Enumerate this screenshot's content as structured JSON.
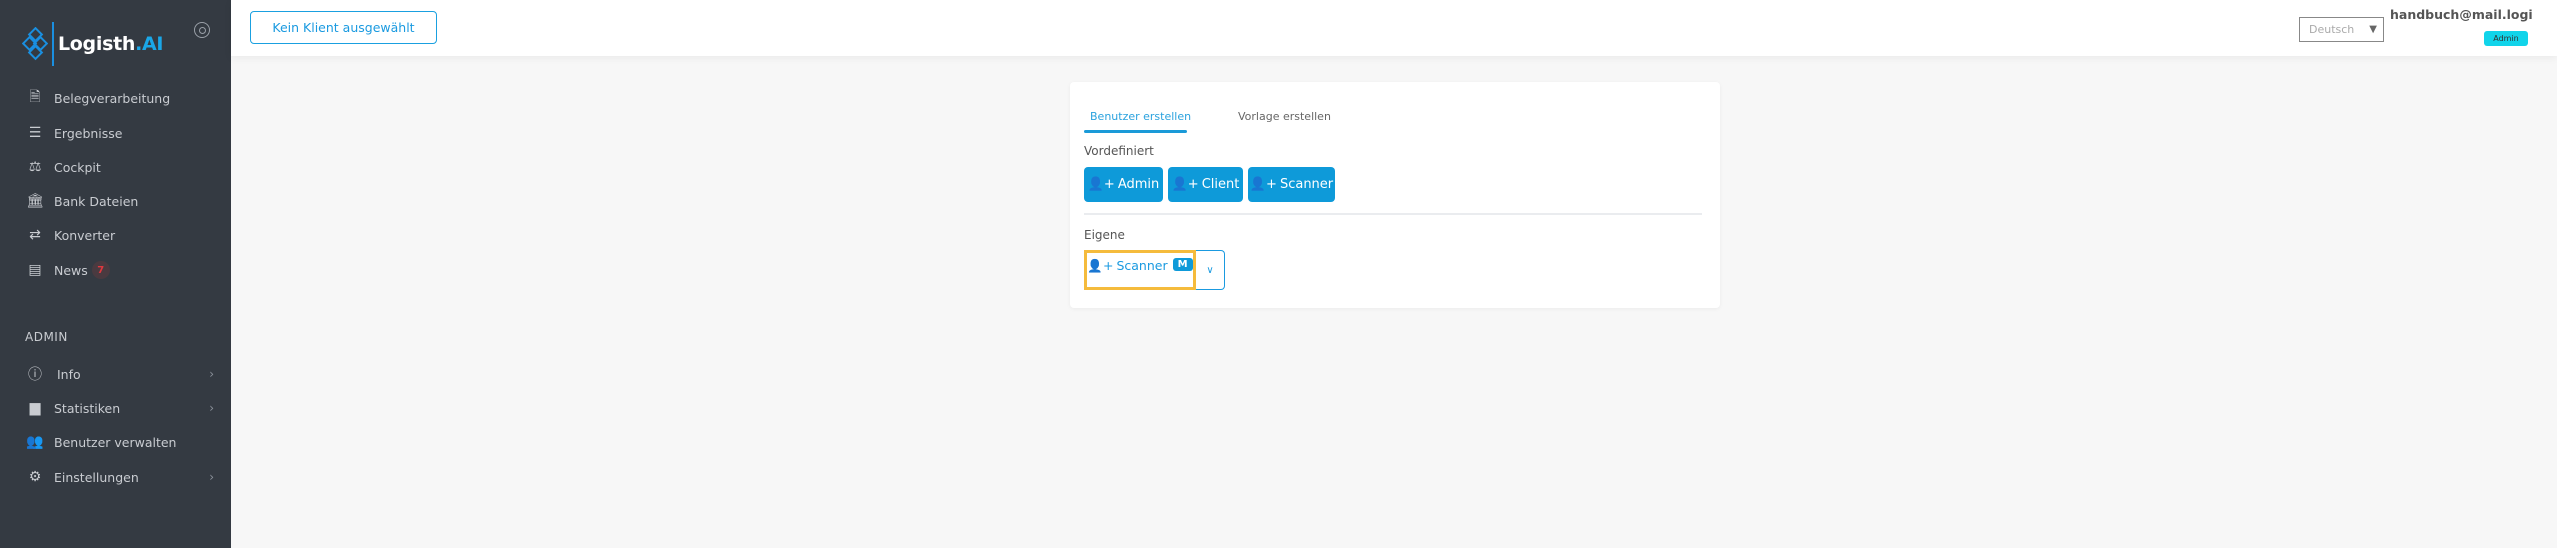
{
  "sidebar": {
    "logo": {
      "main": "Logisth",
      "accent": ".AI"
    },
    "items": [
      {
        "label": "Belegverarbeitung",
        "icon": "file-invoice-icon"
      },
      {
        "label": "Ergebnisse",
        "icon": "list-icon"
      },
      {
        "label": "Cockpit",
        "icon": "scale-icon"
      },
      {
        "label": "Bank Dateien",
        "icon": "bank-icon"
      },
      {
        "label": "Konverter",
        "icon": "exchange-icon"
      },
      {
        "label": "News",
        "icon": "newspaper-icon",
        "badge": "7"
      }
    ],
    "section_title": "ADMIN",
    "admin_items": [
      {
        "label": "Info",
        "icon": "info-icon"
      },
      {
        "label": "Statistiken",
        "icon": "book-icon"
      },
      {
        "label": "Benutzer verwalten",
        "icon": "users-icon"
      },
      {
        "label": "Einstellungen",
        "icon": "cogs-icon"
      }
    ]
  },
  "header": {
    "client_button": "Kein Klient ausgewählt",
    "language": "Deutsch",
    "email": "handbuch@mail.logi",
    "role": "Admin"
  },
  "card": {
    "tabs": [
      {
        "label": "Benutzer erstellen",
        "active": true
      },
      {
        "label": "Vorlage erstellen",
        "active": false
      }
    ],
    "predefined_label": "Vordefiniert",
    "predefined_buttons": [
      "Admin",
      "Client",
      "Scanner"
    ],
    "own_label": "Eigene",
    "own_button": {
      "label": "Scanner",
      "badge": "M"
    }
  },
  "colors": {
    "accent": "#0e9ad9",
    "sidebar": "#343a42",
    "highlight": "#f5bb3c",
    "role_badge": "#11d4ea"
  }
}
